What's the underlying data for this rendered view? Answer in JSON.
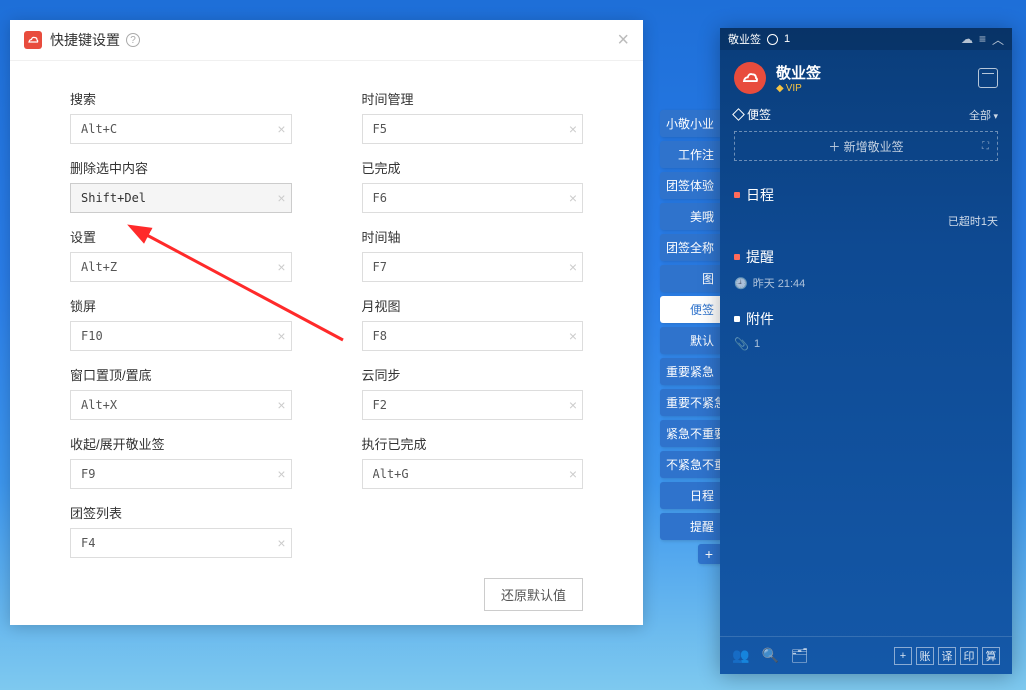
{
  "dialog": {
    "title": "快捷键设置",
    "restore_label": "还原默认值",
    "left": [
      {
        "label": "搜索",
        "value": "Alt+C"
      },
      {
        "label": "删除选中内容",
        "value": "Shift+Del",
        "highlight": true
      },
      {
        "label": "设置",
        "value": "Alt+Z"
      },
      {
        "label": "锁屏",
        "value": "F10"
      },
      {
        "label": "窗口置顶/置底",
        "value": "Alt+X"
      },
      {
        "label": "收起/展开敬业签",
        "value": "F9"
      },
      {
        "label": "团签列表",
        "value": "F4"
      }
    ],
    "right": [
      {
        "label": "时间管理",
        "value": "F5"
      },
      {
        "label": "已完成",
        "value": "F6"
      },
      {
        "label": "时间轴",
        "value": "F7"
      },
      {
        "label": "月视图",
        "value": "F8"
      },
      {
        "label": "云同步",
        "value": "F2"
      },
      {
        "label": "执行已完成",
        "value": "Alt+G"
      }
    ]
  },
  "tags": [
    "小敬小业",
    "工作注",
    "团签体验",
    "美哦",
    "团签全称",
    "图",
    "便签",
    "默认",
    "重要紧急",
    "重要不紧急",
    "紧急不重要",
    "不紧急不重要",
    "日程",
    "提醒"
  ],
  "tag_active_index": 6,
  "sidebar": {
    "titlebar": {
      "name": "敬业签",
      "badge": "1"
    },
    "app_name": "敬业签",
    "vip": "VIP",
    "tab_label": "便签",
    "all_label": "全部",
    "add_label": "＋ 新增敬业签",
    "sections": {
      "schedule": "日程",
      "schedule_badge": "已超时1天",
      "remind": "提醒",
      "remind_time": "昨天 21:44",
      "attachment": "附件",
      "attachment_count": "1"
    },
    "footer_buttons": [
      "+",
      "账",
      "译",
      "印",
      "算"
    ]
  }
}
